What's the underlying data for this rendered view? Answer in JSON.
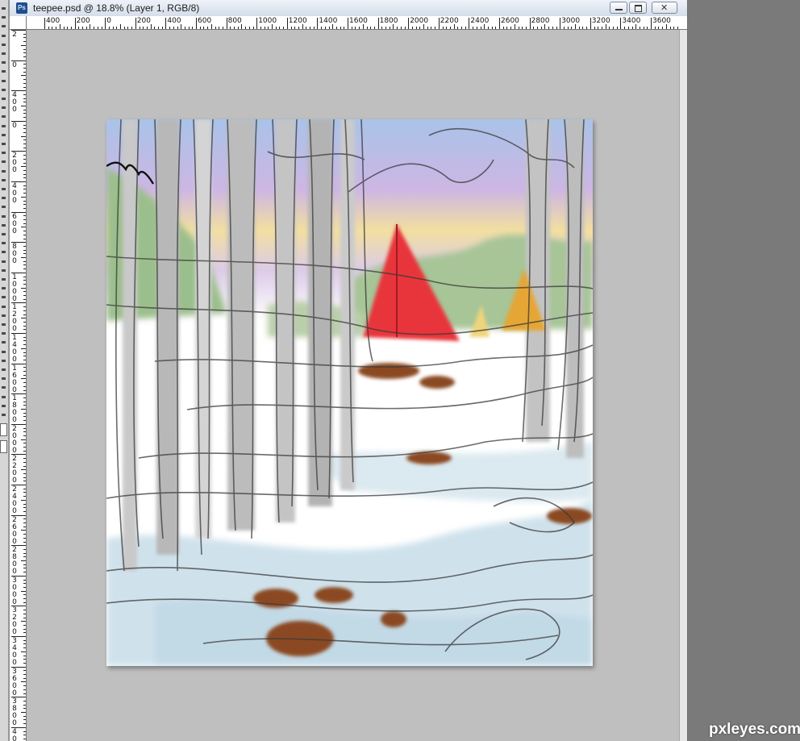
{
  "window": {
    "app_icon_text": "Ps",
    "title": "teepee.psd @ 18.8% (Layer 1, RGB/8)"
  },
  "rulers": {
    "horizontal_labels": [
      "400",
      "200",
      "0",
      "200",
      "400",
      "600",
      "800",
      "1000",
      "1200",
      "1400",
      "1600",
      "1800",
      "2000",
      "2200",
      "2400",
      "2600",
      "2800",
      "3000",
      "3200",
      "3400",
      "3600"
    ],
    "vertical_labels": [
      "2",
      "0",
      "400",
      "0",
      "200",
      "400",
      "600",
      "800",
      "1000",
      "1200",
      "1400",
      "1600",
      "1800",
      "2000",
      "2200",
      "2400",
      "2600",
      "2800",
      "3000",
      "3200",
      "3400",
      "3600",
      "3800",
      "4000"
    ]
  },
  "colors": {
    "canvas_bg": "#bfbfbf",
    "teepee_red": "#e8343a",
    "teepee_yellow": "#e6a634",
    "sky_blue": "#a9c3e8",
    "sky_purple": "#cdb6e4",
    "sky_yellow": "#f2dfa0",
    "forest_green": "#9bbf8c",
    "snow_blue": "#cfe2ec",
    "mud_brown": "#8a4a22"
  },
  "watermark": "pxleyes.com"
}
